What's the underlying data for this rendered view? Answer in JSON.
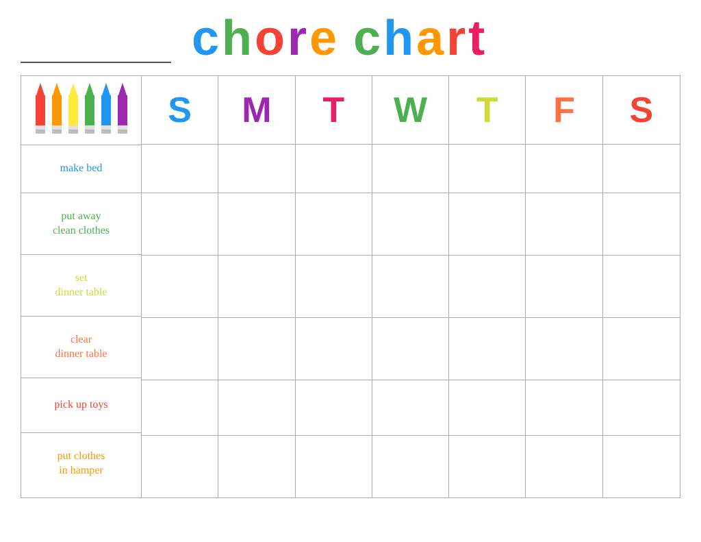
{
  "header": {
    "title_part1": "chore",
    "title_part2": "chart"
  },
  "days": [
    {
      "label": "S",
      "class": "day-S1"
    },
    {
      "label": "M",
      "class": "day-M"
    },
    {
      "label": "T",
      "class": "day-T1"
    },
    {
      "label": "W",
      "class": "day-W"
    },
    {
      "label": "T",
      "class": "day-T2"
    },
    {
      "label": "F",
      "class": "day-F"
    },
    {
      "label": "S",
      "class": "day-S2"
    }
  ],
  "chores": [
    {
      "label": "make bed",
      "colorClass": "h-make",
      "color": "#2196F3"
    },
    {
      "label": "put away\nclean clothes",
      "colorClass": "h-put-away",
      "color": "#4CAF50"
    },
    {
      "label": "set\ndinner table",
      "colorClass": "h-set",
      "color": "#CDDC39"
    },
    {
      "label": "clear\ndinner table",
      "colorClass": "h-clear",
      "color": "#FF7043"
    },
    {
      "label": "pick up toys",
      "colorClass": "h-pick",
      "color": "#F44336"
    },
    {
      "label": "put clothes\nin hamper",
      "colorClass": "h-hamper",
      "color": "#FF9800"
    }
  ],
  "crayons": [
    {
      "color": "#F44336"
    },
    {
      "color": "#FF9800"
    },
    {
      "color": "#FFEB3B"
    },
    {
      "color": "#4CAF50"
    },
    {
      "color": "#2196F3"
    },
    {
      "color": "#9C27B0"
    }
  ]
}
